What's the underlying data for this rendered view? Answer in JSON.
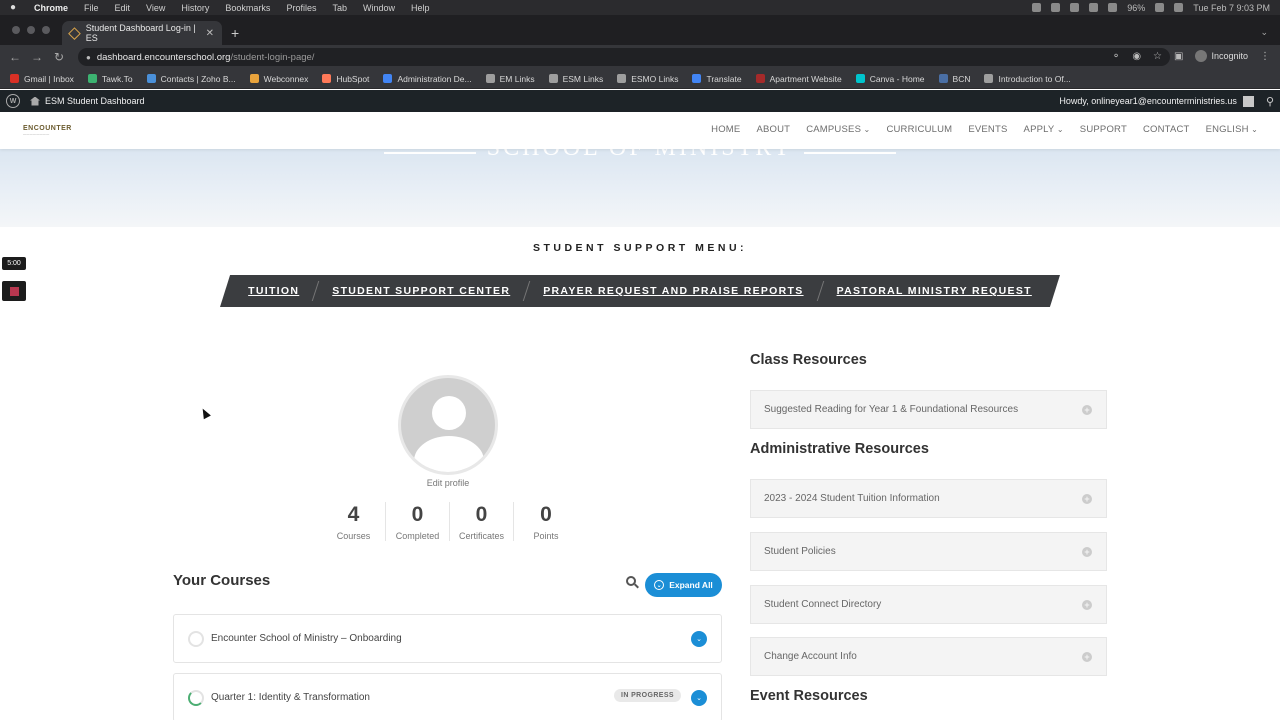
{
  "mac_menubar": {
    "app": "Chrome",
    "menus": [
      "File",
      "Edit",
      "View",
      "History",
      "Bookmarks",
      "Profiles",
      "Tab",
      "Window",
      "Help"
    ],
    "battery": "96%",
    "datetime": "Tue Feb 7 9:03 PM"
  },
  "browser": {
    "tab_title": "Student Dashboard Log-in | ES",
    "url_host": "dashboard.encounterschool.org",
    "url_path": "/student-login-page/",
    "profile_label": "Incognito",
    "bookmarks": [
      {
        "label": "Gmail | Inbox",
        "color": "#d93025"
      },
      {
        "label": "Tawk.To",
        "color": "#3cb371"
      },
      {
        "label": "Contacts | Zoho B...",
        "color": "#4a90d9"
      },
      {
        "label": "Webconnex",
        "color": "#e8a33c"
      },
      {
        "label": "HubSpot",
        "color": "#ff7a59"
      },
      {
        "label": "Administration De...",
        "color": "#4285f4"
      },
      {
        "label": "EM Links",
        "color": "#9e9e9e"
      },
      {
        "label": "ESM Links",
        "color": "#9e9e9e"
      },
      {
        "label": "ESMO Links",
        "color": "#9e9e9e"
      },
      {
        "label": "Translate",
        "color": "#4285f4"
      },
      {
        "label": "Apartment Website",
        "color": "#a52a2a"
      },
      {
        "label": "Canva - Home",
        "color": "#00c4cc"
      },
      {
        "label": "BCN",
        "color": "#4a6fa5"
      },
      {
        "label": "Introduction to Of...",
        "color": "#9e9e9e"
      }
    ]
  },
  "wp_admin": {
    "site_name": "ESM Student Dashboard",
    "howdy": "Howdy, onlineyear1@encounterministries.us"
  },
  "site": {
    "logo_text": "ENCOUNTER",
    "nav": [
      "HOME",
      "ABOUT",
      "CAMPUSES",
      "CURRICULUM",
      "EVENTS",
      "APPLY",
      "SUPPORT",
      "CONTACT",
      "ENGLISH"
    ],
    "hero_title": "SCHOOL OF MINISTRY"
  },
  "support_menu": {
    "title": "STUDENT SUPPORT MENU:",
    "links": [
      "TUITION",
      "STUDENT SUPPORT CENTER",
      "PRAYER REQUEST AND PRAISE REPORTS",
      "PASTORAL MINISTRY REQUEST"
    ]
  },
  "timer": {
    "value": "5:00"
  },
  "profile": {
    "edit_label": "Edit profile",
    "stats": [
      {
        "value": "4",
        "label": "Courses"
      },
      {
        "value": "0",
        "label": "Completed"
      },
      {
        "value": "0",
        "label": "Certificates"
      },
      {
        "value": "0",
        "label": "Points"
      }
    ]
  },
  "courses": {
    "title": "Your Courses",
    "expand_label": "Expand All",
    "items": [
      {
        "title": "Encounter School of Ministry – Onboarding",
        "status": ""
      },
      {
        "title": "Quarter 1: Identity & Transformation",
        "status": "IN PROGRESS"
      }
    ]
  },
  "resources": {
    "class_heading": "Class Resources",
    "class_items": [
      "Suggested Reading for Year 1 & Foundational Resources"
    ],
    "admin_heading": "Administrative Resources",
    "admin_items": [
      "2023 - 2024 Student Tuition Information",
      "Student Policies",
      "Student Connect Directory",
      "Change Account Info"
    ],
    "event_heading": "Event Resources"
  },
  "colors": {
    "accent_blue": "#1b8ed6",
    "support_bar": "#3b3d40",
    "wp_bar": "#1d2327",
    "progress_green": "#4cae73"
  }
}
